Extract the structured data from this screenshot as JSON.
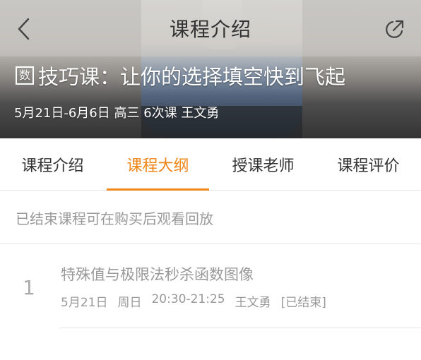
{
  "header": {
    "title": "课程介绍",
    "back_icon": "chevron-left-icon",
    "share_icon": "share-icon"
  },
  "course": {
    "subject_badge": "数",
    "title": "技巧课：让你的选择填空快到飞起",
    "meta": "5月21日-6月6日 高三 6次课 王文勇"
  },
  "tabs": [
    {
      "label": "课程介绍",
      "active": false
    },
    {
      "label": "课程大纲",
      "active": true
    },
    {
      "label": "授课老师",
      "active": false
    },
    {
      "label": "课程评价",
      "active": false
    }
  ],
  "notice": "已结束课程可在购买后观看回放",
  "lessons": [
    {
      "index": "1",
      "title": "特殊值与极限法秒杀函数图像",
      "date": "5月21日",
      "weekday": "周日",
      "time": "20:30-21:25",
      "teacher": "王文勇",
      "status": "[已结束]"
    }
  ],
  "colors": {
    "accent": "#f08519",
    "text": "#333333",
    "muted": "#999999",
    "divider": "#e5e5e5"
  }
}
